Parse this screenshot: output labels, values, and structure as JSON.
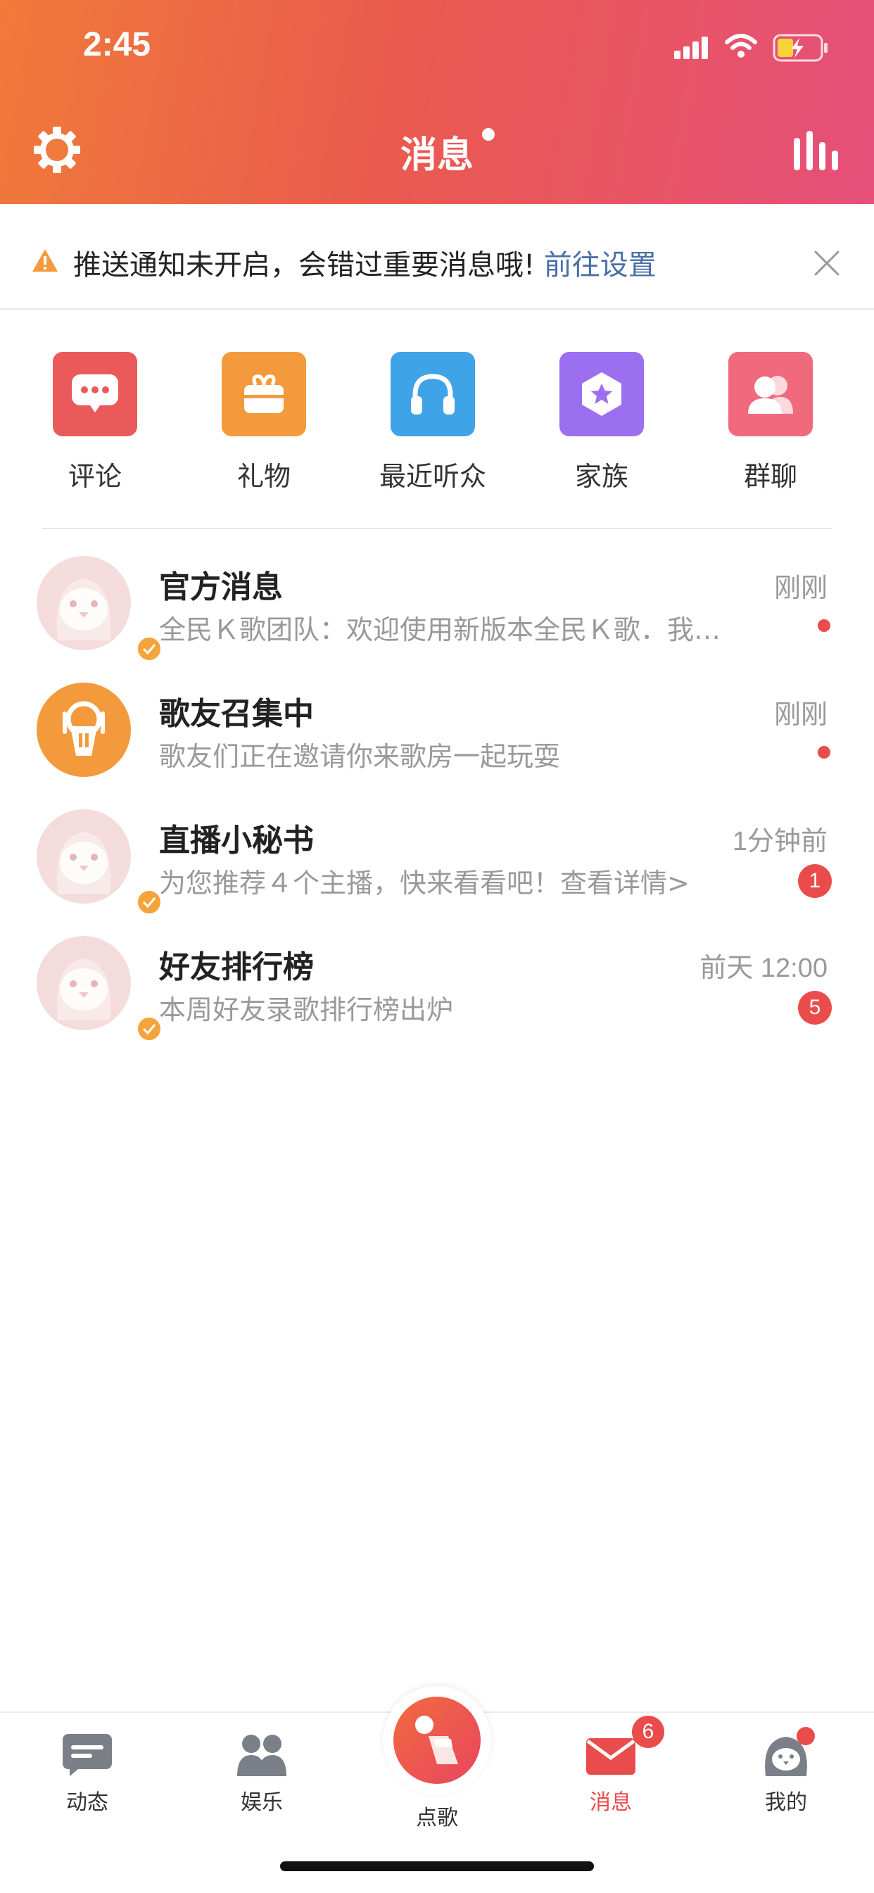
{
  "status_bar": {
    "time": "2:45"
  },
  "header": {
    "title": "消息"
  },
  "notice": {
    "text": "推送通知未开启，会错过重要消息哦!",
    "link": "前往设置"
  },
  "quick_actions": [
    {
      "label": "评论",
      "icon": "comment-icon",
      "color": "#ea5a5a"
    },
    {
      "label": "礼物",
      "icon": "gift-icon",
      "color": "#f39a3d"
    },
    {
      "label": "最近听众",
      "icon": "headphones-icon",
      "color": "#3fa3e8"
    },
    {
      "label": "家族",
      "icon": "family-icon",
      "color": "#9b6ff0"
    },
    {
      "label": "群聊",
      "icon": "group-chat-icon",
      "color": "#f0697c"
    }
  ],
  "messages": [
    {
      "title": "官方消息",
      "subtitle": "全民Ｋ歌团队：欢迎使用新版本全民Ｋ歌．我…",
      "time": "刚刚",
      "indicator": "dot"
    },
    {
      "title": "歌友召集中",
      "subtitle": "歌友们正在邀请你来歌房一起玩耍",
      "time": "刚刚",
      "indicator": "dot"
    },
    {
      "title": "直播小秘书",
      "subtitle": "为您推荐４个主播，快来看看吧！查看详情>",
      "time": "1分钟前",
      "count": "1"
    },
    {
      "title": "好友排行榜",
      "subtitle": "本周好友录歌排行榜出炉",
      "time": "前天 12:00",
      "count": "5"
    }
  ],
  "tabbar": {
    "tabs": [
      "动态",
      "娱乐",
      "点歌",
      "消息",
      "我的"
    ],
    "active": "消息",
    "message_badge": "6"
  },
  "colors": {
    "accent": "#ea4c4c",
    "header_start": "#f07a3a",
    "header_end": "#e64f7a",
    "link": "#4a6fa5"
  }
}
